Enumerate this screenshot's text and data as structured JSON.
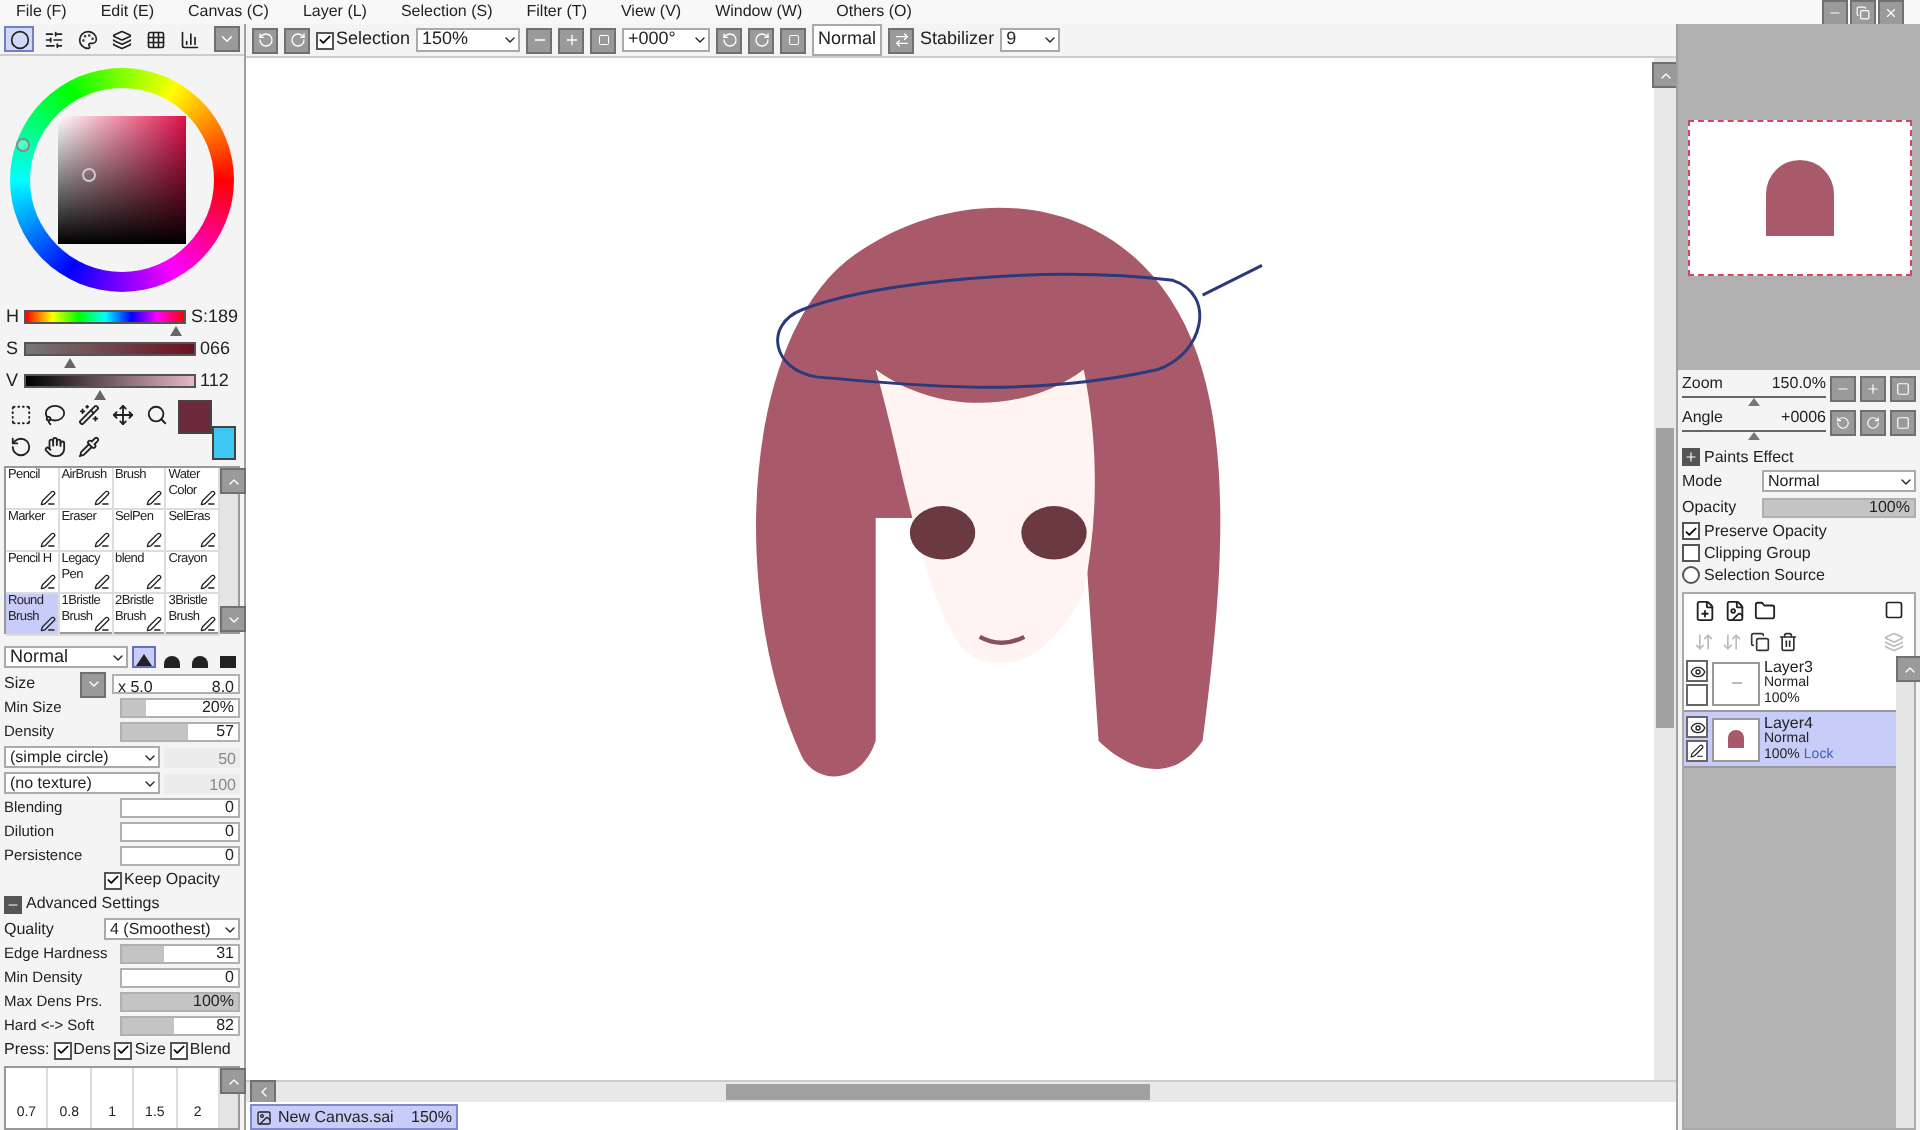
{
  "menu": [
    "File (F)",
    "Edit (E)",
    "Canvas (C)",
    "Layer (L)",
    "Selection (S)",
    "Filter (T)",
    "View (V)",
    "Window (W)",
    "Others (O)"
  ],
  "color_tabs": [
    {
      "kind": "wheel",
      "selected": true
    },
    {
      "kind": "rgb",
      "selected": false
    },
    {
      "kind": "hsv",
      "selected": false
    },
    {
      "kind": "mixer",
      "selected": false
    },
    {
      "kind": "swatches",
      "selected": false
    },
    {
      "kind": "scratch",
      "selected": false
    }
  ],
  "hsv": [
    {
      "label": "H",
      "reading": "S:189",
      "level": 0.95,
      "kind": "hue"
    },
    {
      "label": "S",
      "reading": "066",
      "level": 0.26,
      "kind": "sat"
    },
    {
      "label": "V",
      "reading": "112",
      "level": 0.44,
      "kind": "val"
    }
  ],
  "colors": [
    {
      "color": "#6b2a3a"
    },
    {
      "color": "#3cc8f0"
    }
  ],
  "tools": [
    {
      "kind": "select"
    },
    {
      "kind": "lasso"
    },
    {
      "kind": "wand"
    },
    {
      "kind": "move"
    },
    {
      "kind": "zoom"
    },
    {
      "kind": "rotate"
    },
    {
      "kind": "hand"
    },
    {
      "kind": "picker"
    }
  ],
  "brushes": [
    {
      "label": "Pencil",
      "selected": false
    },
    {
      "label": "AirBrush",
      "selected": false
    },
    {
      "label": "Brush",
      "selected": false
    },
    {
      "label": "Water Color",
      "selected": false
    },
    {
      "label": "Marker",
      "selected": false
    },
    {
      "label": "Eraser",
      "selected": false
    },
    {
      "label": "SelPen",
      "selected": false
    },
    {
      "label": "SelEras",
      "selected": false
    },
    {
      "label": "Pencil H",
      "selected": false
    },
    {
      "label": "Legacy Pen",
      "selected": false
    },
    {
      "label": "blend",
      "selected": false
    },
    {
      "label": "Crayon",
      "selected": false
    },
    {
      "label": "Round Brush",
      "selected": true
    },
    {
      "label": "1Bristle Brush",
      "selected": false
    },
    {
      "label": "2Bristle Brush",
      "selected": false
    },
    {
      "label": "3Bristle Brush",
      "selected": false
    }
  ],
  "brush_settings": {
    "mode": "Normal",
    "shapes": [
      {
        "selected": true
      },
      {
        "selected": false
      },
      {
        "selected": false
      },
      {
        "selected": false
      }
    ],
    "size": {
      "label": "Size",
      "multiplier": "x 5.0",
      "value": "8.0"
    },
    "rows": [
      {
        "kind": "bar",
        "label": "Min Size",
        "value": "20%",
        "level": 0.2
      },
      {
        "kind": "bar",
        "label": "Density",
        "value": "57",
        "level": 0.57
      },
      {
        "kind": "select",
        "label": "(simple circle)",
        "value": "50"
      },
      {
        "kind": "select",
        "label": "(no texture)",
        "value": "100"
      },
      {
        "kind": "bar",
        "label": "Blending",
        "value": "0",
        "level": 0
      },
      {
        "kind": "bar",
        "label": "Dilution",
        "value": "0",
        "level": 0
      },
      {
        "kind": "bar",
        "label": "Persistence",
        "value": "0",
        "level": 0
      },
      {
        "kind": "check",
        "label": "Keep Opacity",
        "checked": true
      },
      {
        "kind": "header",
        "label": "Advanced Settings",
        "expanded": true
      },
      {
        "kind": "dropdown",
        "label": "Quality",
        "value": "4 (Smoothest)"
      },
      {
        "kind": "bar",
        "label": "Edge Hardness",
        "value": "31",
        "level": 0.36
      },
      {
        "kind": "bar",
        "label": "Min Density",
        "value": "0",
        "level": 0
      },
      {
        "kind": "bar",
        "label": "Max Dens Prs.",
        "value": "100%",
        "level": 1
      },
      {
        "kind": "bar",
        "label": "Hard <-> Soft",
        "value": "82",
        "level": 0.45
      }
    ],
    "press": {
      "label": "Press:",
      "options": [
        {
          "label": "Dens",
          "checked": true
        },
        {
          "label": "Size",
          "checked": true
        },
        {
          "label": "Blend",
          "checked": true
        }
      ]
    },
    "dot_sizes": [
      "0.7",
      "0.8",
      "1",
      "1.5",
      "2"
    ]
  },
  "toolbar": {
    "selection": {
      "label": "Selection",
      "checked": true
    },
    "zoom": "150%",
    "angle": "+000°",
    "mode": "Normal",
    "stabilizer_label": "Stabilizer",
    "stabilizer": "9"
  },
  "navigator": {
    "zoom": {
      "label": "Zoom",
      "value": "150.0%",
      "level": 0.5
    },
    "angle": {
      "label": "Angle",
      "value": "+0006",
      "level": 0.5
    }
  },
  "layer_panel": {
    "paints_effect": "Paints Effect",
    "mode_label": "Mode",
    "mode": "Normal",
    "opacity_label": "Opacity",
    "opacity": {
      "value": "100%",
      "level": 1
    },
    "options": [
      {
        "kind": "check",
        "label": "Preserve Opacity",
        "checked": true
      },
      {
        "kind": "check",
        "label": "Clipping Group",
        "checked": false
      },
      {
        "kind": "radio",
        "label": "Selection Source",
        "checked": false
      }
    ],
    "layers": [
      {
        "name": "Layer3",
        "mode": "Normal",
        "opacity": "100%",
        "visible": true,
        "selected": false,
        "kind": "sketch"
      },
      {
        "name": "Layer4",
        "mode": "Normal",
        "opacity": "100%",
        "lock": "Lock",
        "visible": true,
        "selected": true,
        "kind": "paint"
      }
    ]
  },
  "document_tabs": [
    {
      "name": "New Canvas.sai",
      "zoom": "150%",
      "selected": true
    }
  ]
}
